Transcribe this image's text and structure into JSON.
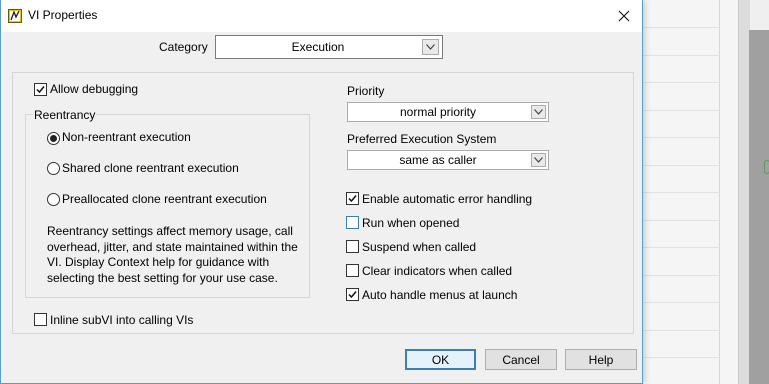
{
  "window": {
    "title": "VI Properties"
  },
  "category": {
    "label": "Category",
    "value": "Execution"
  },
  "execution": {
    "allow_debugging": {
      "label": "Allow debugging",
      "checked": true
    },
    "reentrancy": {
      "title": "Reentrancy",
      "options": [
        {
          "label": "Non-reentrant execution",
          "selected": true
        },
        {
          "label": "Shared clone reentrant execution",
          "selected": false
        },
        {
          "label": "Preallocated clone reentrant execution",
          "selected": false
        }
      ],
      "note": "Reentrancy settings affect memory usage, call overhead, jitter, and state maintained within the VI. Display Context help for guidance with selecting the best setting for your use case."
    },
    "inline_subvi": {
      "label": "Inline subVI into calling VIs",
      "checked": false
    },
    "priority": {
      "label": "Priority",
      "value": "normal priority"
    },
    "preferred_execution_system": {
      "label": "Preferred Execution System",
      "value": "same as caller"
    },
    "options": [
      {
        "label": "Enable automatic error handling",
        "checked": true
      },
      {
        "label": "Run when opened",
        "checked": false
      },
      {
        "label": "Suspend when called",
        "checked": false
      },
      {
        "label": "Clear indicators when called",
        "checked": false
      },
      {
        "label": "Auto handle menus at launch",
        "checked": true
      }
    ]
  },
  "buttons": {
    "ok": "OK",
    "cancel": "Cancel",
    "help": "Help"
  },
  "icons": [
    "vi-properties-app-icon",
    "close-icon",
    "chevron-down-icon",
    "checkmark-icon"
  ],
  "colors": {
    "dialog_bg": "#f0f0f0",
    "accent_border": "#3c7fb1",
    "window_border": "#5b9bd5"
  }
}
